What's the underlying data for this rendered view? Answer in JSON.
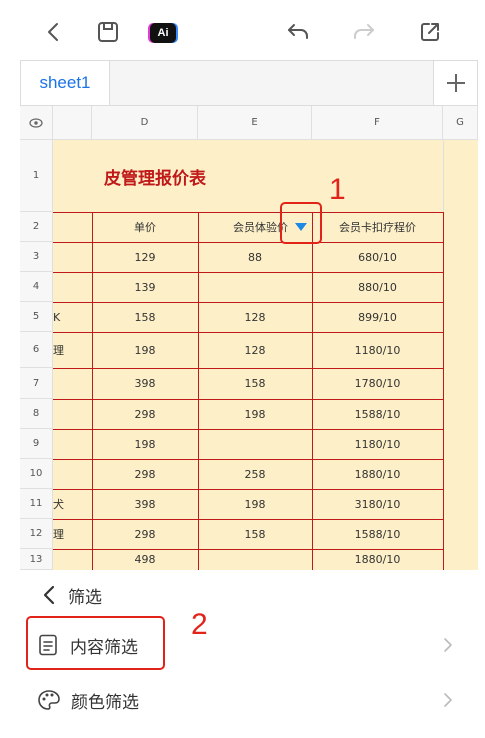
{
  "toolbar": {
    "back_icon": "chevron-left-icon",
    "save_icon": "save-icon",
    "ai_label": "Ai",
    "undo_icon": "undo-icon",
    "redo_icon": "redo-icon",
    "share_icon": "share-icon"
  },
  "tabs": {
    "sheet_name": "sheet1",
    "add_icon": "plus-icon"
  },
  "grid": {
    "eye_icon": "eye-icon",
    "columns": [
      "D",
      "E",
      "F",
      "G"
    ],
    "rows": [
      "1",
      "2",
      "3",
      "4",
      "5",
      "6",
      "7",
      "8",
      "9",
      "10",
      "11",
      "12",
      "13"
    ],
    "title": "皮管理报价表",
    "headers": {
      "unit_price": "单价",
      "member_trial": "会员体验价",
      "member_card": "会员卡扣疗程价"
    },
    "data": [
      {
        "left": "",
        "d": "129",
        "e": "88",
        "f": "680/10"
      },
      {
        "left": "",
        "d": "139",
        "e": "",
        "f": "880/10"
      },
      {
        "left": "K",
        "d": "158",
        "e": "128",
        "f": "899/10"
      },
      {
        "left": "理",
        "d": "198",
        "e": "128",
        "f": "1180/10"
      },
      {
        "left": "",
        "d": "398",
        "e": "158",
        "f": "1780/10"
      },
      {
        "left": "",
        "d": "298",
        "e": "198",
        "f": "1588/10"
      },
      {
        "left": "",
        "d": "198",
        "e": "",
        "f": "1180/10"
      },
      {
        "left": "",
        "d": "298",
        "e": "258",
        "f": "1880/10"
      },
      {
        "left": "犬",
        "d": "398",
        "e": "198",
        "f": "3180/10"
      },
      {
        "left": "理",
        "d": "298",
        "e": "158",
        "f": "1588/10"
      },
      {
        "left": "",
        "d": "498",
        "e": "",
        "f": "1880/10"
      }
    ],
    "filter_icon": "filter-dropdown-icon"
  },
  "annotations": {
    "one": "1",
    "two": "2"
  },
  "panel": {
    "back_label": "筛选",
    "content_filter": "内容筛选",
    "color_filter": "颜色筛选"
  },
  "colors": {
    "accent": "#1a73e8",
    "sheet_bg": "#fdf0c8",
    "border_red": "#c0191a",
    "annotation": "#e2231a"
  }
}
